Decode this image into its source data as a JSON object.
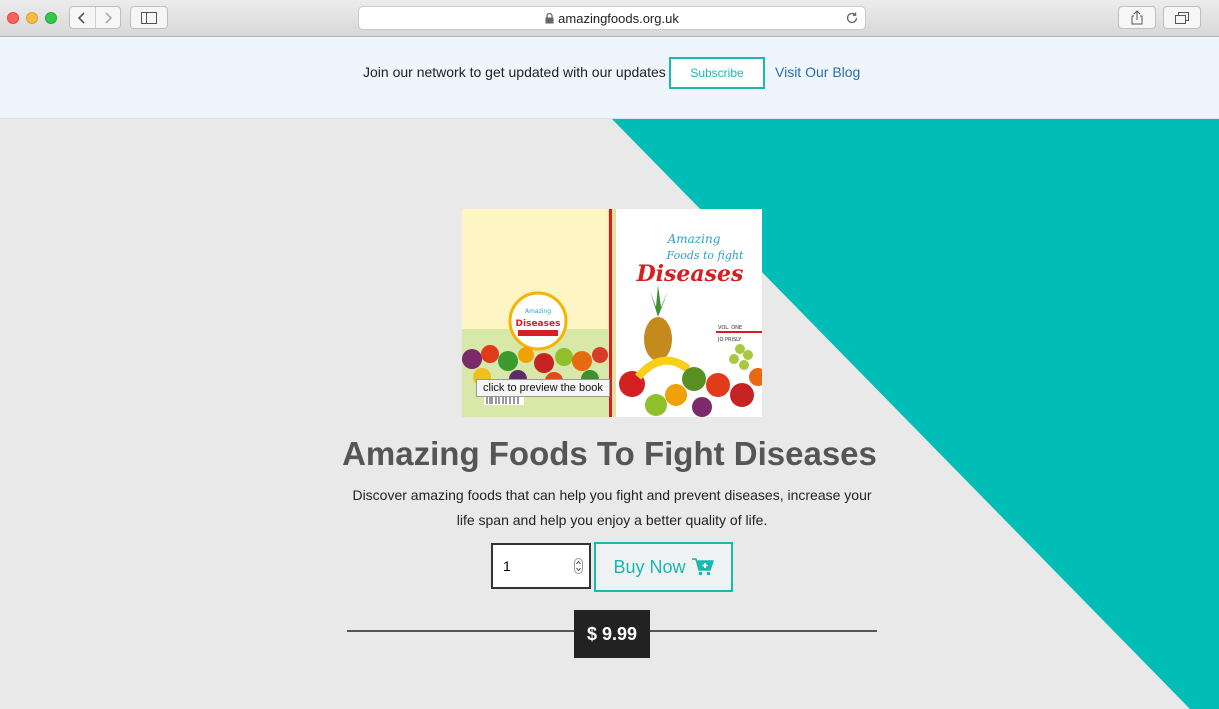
{
  "browser": {
    "url": "amazingfoods.org.uk"
  },
  "banner": {
    "text": "Join our network to get updated with our updates",
    "subscribe_label": "Subscribe",
    "blog_link": "Visit Our Blog"
  },
  "product": {
    "tooltip": "click to preview the book",
    "title": "Amazing Foods To Fight Diseases",
    "description": "Discover amazing foods that can help you fight and prevent diseases, increase your life span and help you enjoy a better quality of life.",
    "quantity": "1",
    "buy_label": "Buy Now",
    "price": "$ 9.99"
  },
  "book_cover": {
    "title_line1": "Amazing",
    "title_line2": "Foods to fight",
    "title_line3": "Diseases",
    "volume": "VOL. ONE",
    "author": "JO PRISLY"
  },
  "colors": {
    "accent": "#1bb7b0",
    "teal_panel": "#00bdb6",
    "link": "#2a6ea8",
    "price_bg": "#222222"
  }
}
